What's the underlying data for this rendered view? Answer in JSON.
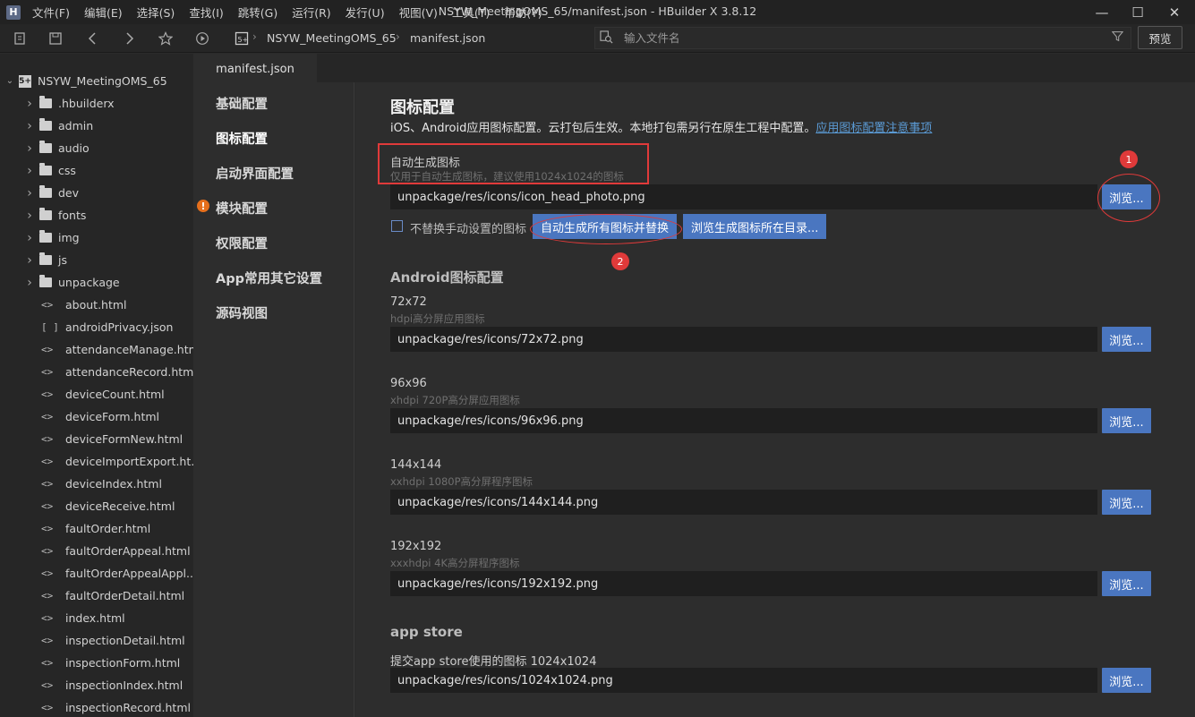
{
  "app": {
    "logo_char": "H",
    "window_title": "NSYW_MeetingOMS_65/manifest.json - HBuilder X 3.8.12",
    "menu": [
      "文件(F)",
      "编辑(E)",
      "选择(S)",
      "查找(I)",
      "跳转(G)",
      "运行(R)",
      "发行(U)",
      "视图(V)",
      "工具(T)",
      "帮助(Y)"
    ],
    "window_controls": {
      "minimize": "—",
      "maximize": "☐",
      "close": "✕"
    }
  },
  "toolbar": {
    "breadcrumb": [
      "NSYW_MeetingOMS_65",
      "manifest.json"
    ],
    "search_placeholder": "输入文件名",
    "preview_label": "预览"
  },
  "sidebar": {
    "project_name": "NSYW_MeetingOMS_65",
    "items": [
      {
        "type": "folder",
        "label": ".hbuilderx"
      },
      {
        "type": "folder",
        "label": "admin"
      },
      {
        "type": "folder",
        "label": "audio"
      },
      {
        "type": "folder",
        "label": "css"
      },
      {
        "type": "folder",
        "label": "dev"
      },
      {
        "type": "folder",
        "label": "fonts"
      },
      {
        "type": "folder",
        "label": "img"
      },
      {
        "type": "folder",
        "label": "js"
      },
      {
        "type": "folder",
        "label": "unpackage"
      },
      {
        "type": "html",
        "label": "about.html"
      },
      {
        "type": "json",
        "label": "androidPrivacy.json"
      },
      {
        "type": "html",
        "label": "attendanceManage.html"
      },
      {
        "type": "html",
        "label": "attendanceRecord.html"
      },
      {
        "type": "html",
        "label": "deviceCount.html"
      },
      {
        "type": "html",
        "label": "deviceForm.html"
      },
      {
        "type": "html",
        "label": "deviceFormNew.html"
      },
      {
        "type": "html",
        "label": "deviceImportExport.ht..."
      },
      {
        "type": "html",
        "label": "deviceIndex.html"
      },
      {
        "type": "html",
        "label": "deviceReceive.html"
      },
      {
        "type": "html",
        "label": "faultOrder.html"
      },
      {
        "type": "html",
        "label": "faultOrderAppeal.html"
      },
      {
        "type": "html",
        "label": "faultOrderAppealAppl..."
      },
      {
        "type": "html",
        "label": "faultOrderDetail.html"
      },
      {
        "type": "html",
        "label": "index.html"
      },
      {
        "type": "html",
        "label": "inspectionDetail.html"
      },
      {
        "type": "html",
        "label": "inspectionForm.html"
      },
      {
        "type": "html",
        "label": "inspectionIndex.html"
      },
      {
        "type": "html",
        "label": "inspectionRecord.html"
      }
    ]
  },
  "editor": {
    "tab_label": "manifest.json"
  },
  "manifest_nav": [
    {
      "label": "基础配置",
      "warn": false,
      "active": false
    },
    {
      "label": "图标配置",
      "warn": false,
      "active": true
    },
    {
      "label": "启动界面配置",
      "warn": false,
      "active": false
    },
    {
      "label": "模块配置",
      "warn": true,
      "active": false
    },
    {
      "label": "权限配置",
      "warn": false,
      "active": false
    },
    {
      "label": "App常用其它设置",
      "warn": false,
      "active": false
    },
    {
      "label": "源码视图",
      "warn": false,
      "active": false
    }
  ],
  "content": {
    "title": "图标配置",
    "desc": "iOS、Android应用图标配置。云打包后生效。本地打包需另行在原生工程中配置。",
    "desc_link": "应用图标配置注意事项",
    "auto": {
      "label": "自动生成图标",
      "hint": "仅用于自动生成图标，建议使用1024x1024的图标",
      "value": "unpackage/res/icons/icon_head_photo.png",
      "browse": "浏览...",
      "checkbox_label": "不替换手动设置的图标",
      "btn_generate": "自动生成所有图标并替换",
      "btn_browse_dir": "浏览生成图标所在目录..."
    },
    "android_title": "Android图标配置",
    "android_icons": [
      {
        "label": "72x72",
        "hint": "hdpi高分屏应用图标",
        "value": "unpackage/res/icons/72x72.png",
        "browse": "浏览..."
      },
      {
        "label": "96x96",
        "hint": "xhdpi 720P高分屏应用图标",
        "value": "unpackage/res/icons/96x96.png",
        "browse": "浏览..."
      },
      {
        "label": "144x144",
        "hint": "xxhdpi 1080P高分屏程序图标",
        "value": "unpackage/res/icons/144x144.png",
        "browse": "浏览..."
      },
      {
        "label": "192x192",
        "hint": "xxxhdpi 4K高分屏程序图标",
        "value": "unpackage/res/icons/192x192.png",
        "browse": "浏览..."
      }
    ],
    "appstore_title": "app store",
    "appstore": {
      "label": "提交app store使用的图标 1024x1024",
      "value": "unpackage/res/icons/1024x1024.png",
      "browse": "浏览..."
    }
  },
  "annotations": {
    "badge1": "1",
    "badge2": "2"
  },
  "colors": {
    "accent_button": "#4a76c0",
    "annotation_red": "#e03a3a",
    "warning_orange": "#e66f1c",
    "link": "#5b9bd5"
  }
}
